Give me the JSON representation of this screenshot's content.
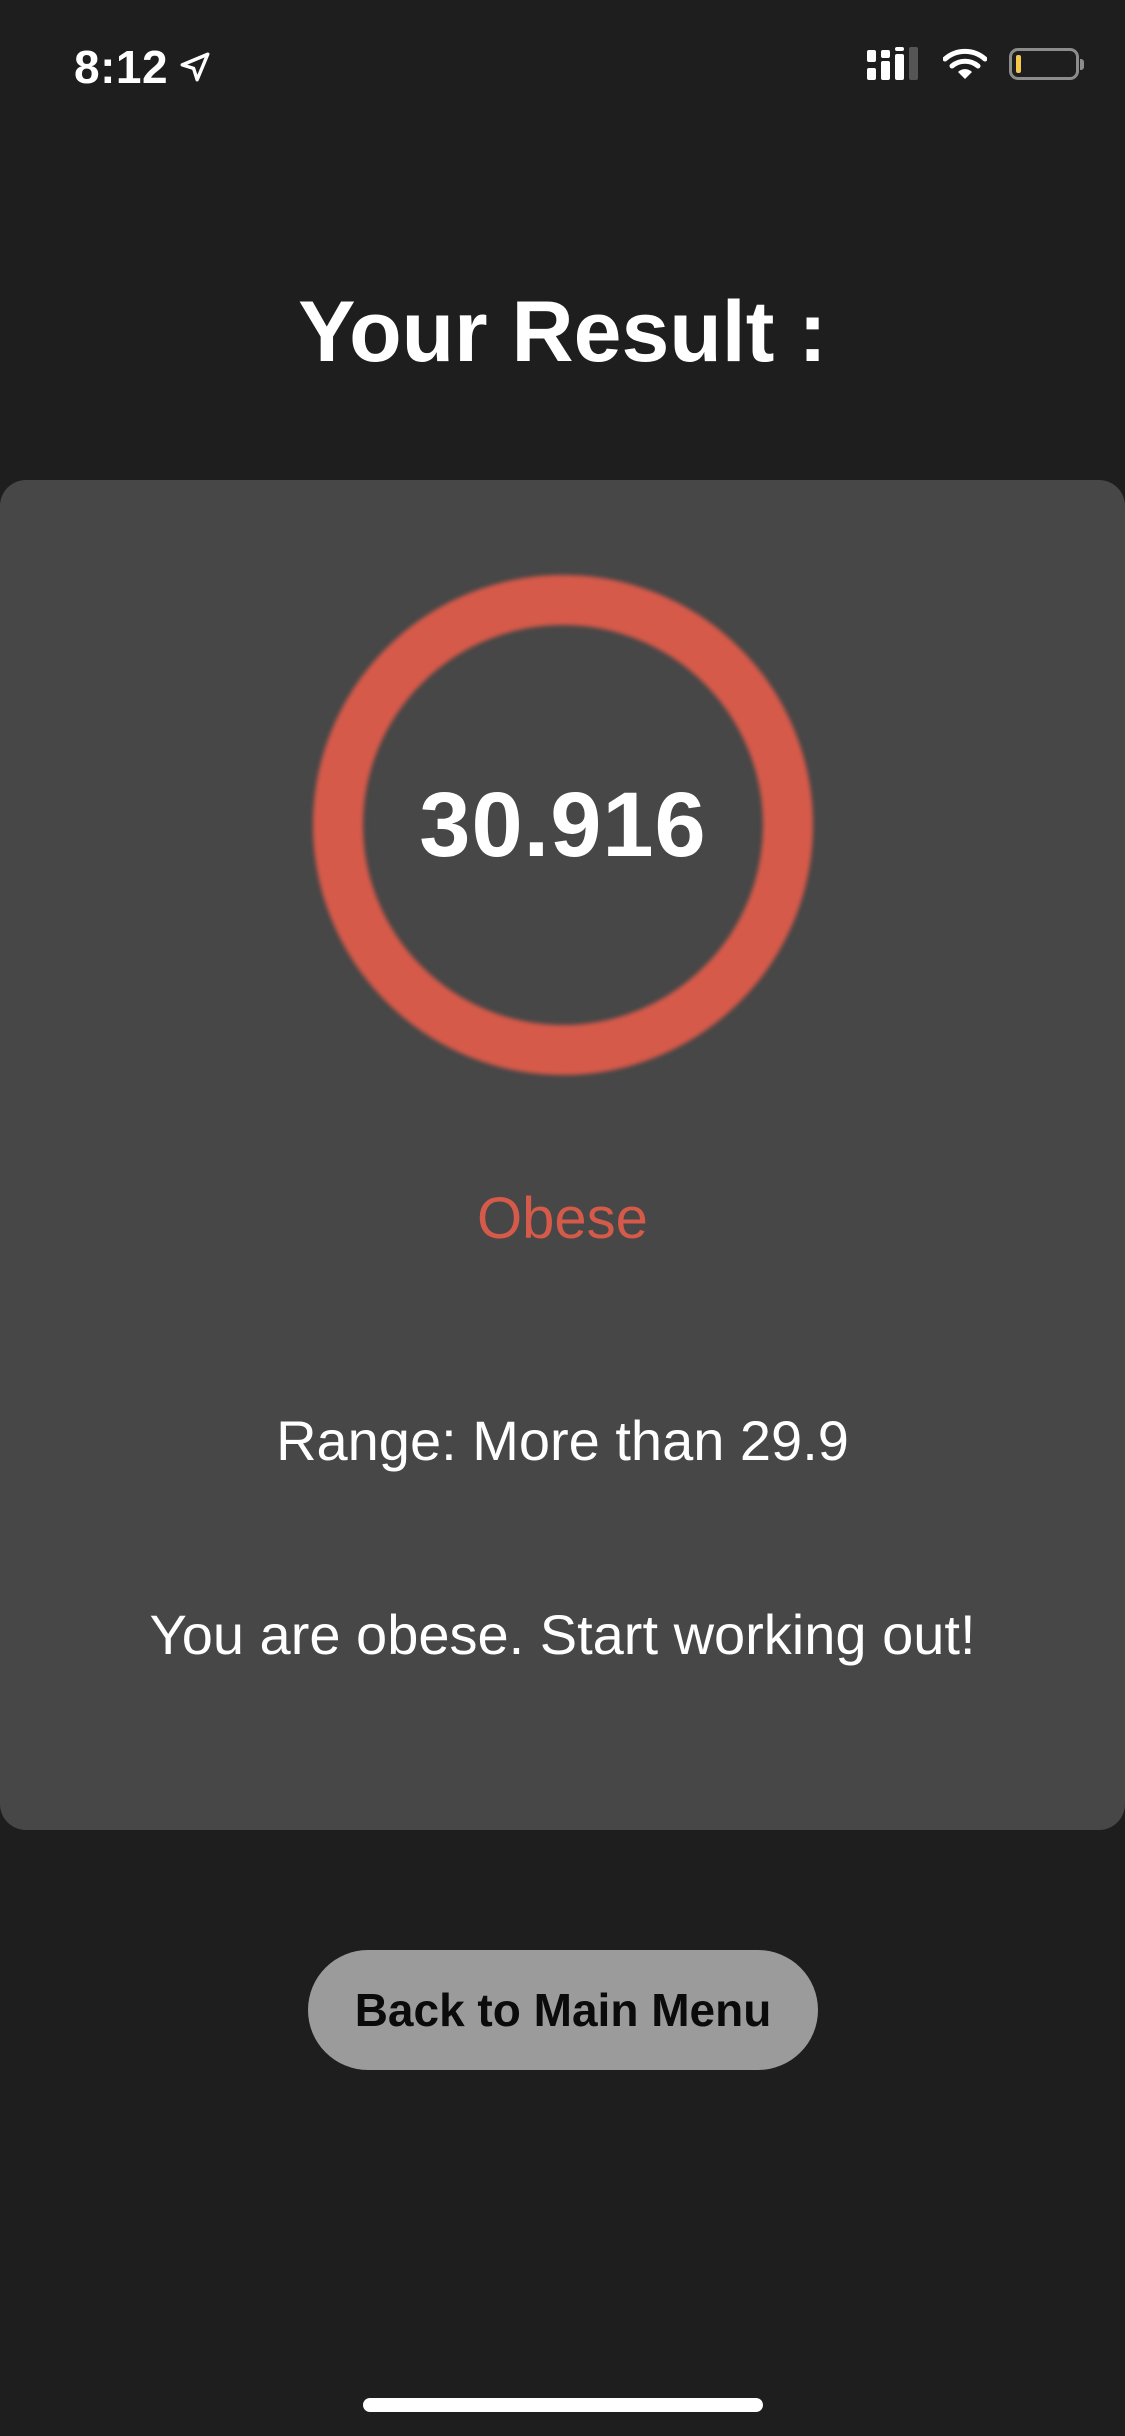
{
  "status_bar": {
    "time": "8:12",
    "icons": [
      "location-arrow-icon",
      "cellular-signal-icon",
      "wifi-icon",
      "battery-icon"
    ],
    "battery_level": 0.1
  },
  "header": {
    "title": "Your Result :"
  },
  "result": {
    "bmi_value": "30.916",
    "category": "Obese",
    "range": "Range: More than 29.9",
    "advice": "You are obese. Start working out!"
  },
  "actions": {
    "back_label": "Back to Main Menu"
  },
  "colors": {
    "background": "#1e1e1e",
    "card": "#474747",
    "accent": "#d65a4a",
    "button": "#9b9b9b"
  }
}
